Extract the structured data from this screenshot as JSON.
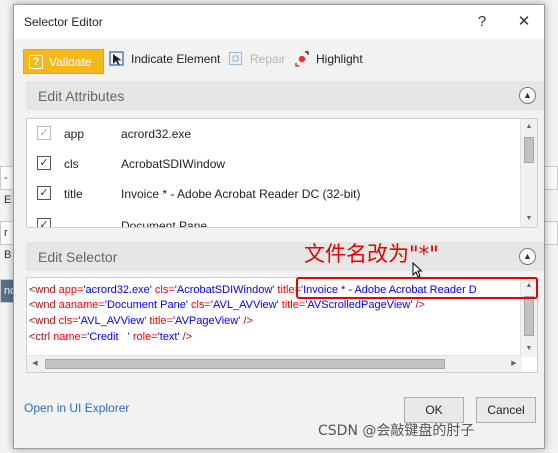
{
  "background": {
    "row1": "- E",
    "row2": "r B",
    "row3": "nd"
  },
  "dialog": {
    "title": "Selector Editor",
    "help_label": "?",
    "close_label": "✕"
  },
  "toolbar": {
    "validate_label": "Validate",
    "indicate_label": "Indicate Element",
    "repair_label": "Repair",
    "highlight_label": "Highlight"
  },
  "edit_attributes": {
    "title": "Edit Attributes",
    "rows": [
      {
        "name": "app",
        "value": "acrord32.exe",
        "checked": true,
        "disabled": true
      },
      {
        "name": "cls",
        "value": "AcrobatSDIWindow",
        "checked": true,
        "disabled": false
      },
      {
        "name": "title",
        "value": "Invoice * - Adobe Acrobat Reader DC (32-bit)",
        "checked": true,
        "disabled": false
      },
      {
        "name": "",
        "value": "Document Pane",
        "checked": true,
        "disabled": false
      }
    ]
  },
  "edit_selector": {
    "title": "Edit Selector",
    "annotation": "文件名改为\"*\"",
    "lines": {
      "l1": {
        "tag": "<wnd ",
        "a1": "app=",
        "v1": "'acrord32.exe'",
        "a2": " cls=",
        "v2": "'AcrobatSDIWindow'",
        "a3": " title=",
        "v3": "'Invoice * - Adobe Acrobat Reader D"
      },
      "l2": {
        "tag": "<wnd ",
        "a1": "aaname=",
        "v1": "'Document Pane'",
        "a2": " cls=",
        "v2": "'AVL_AVView'",
        "a3": " title=",
        "v3": "'AVScrolledPageView'",
        "end": " />"
      },
      "l3": {
        "tag": "<wnd ",
        "a1": "cls=",
        "v1": "'AVL_AVView'",
        "a2": " title=",
        "v2": "'AVPageView'",
        "end": " />"
      },
      "l4": {
        "tag": "<ctrl ",
        "a1": "name=",
        "v1": "'Credit   '",
        "a2": " role=",
        "v2": "'text'",
        "end": " />"
      }
    }
  },
  "footer": {
    "explorer_link": "Open in UI Explorer",
    "ok_label": "OK",
    "cancel_label": "Cancel"
  },
  "watermark": "CSDN @会敲键盘的肘子"
}
